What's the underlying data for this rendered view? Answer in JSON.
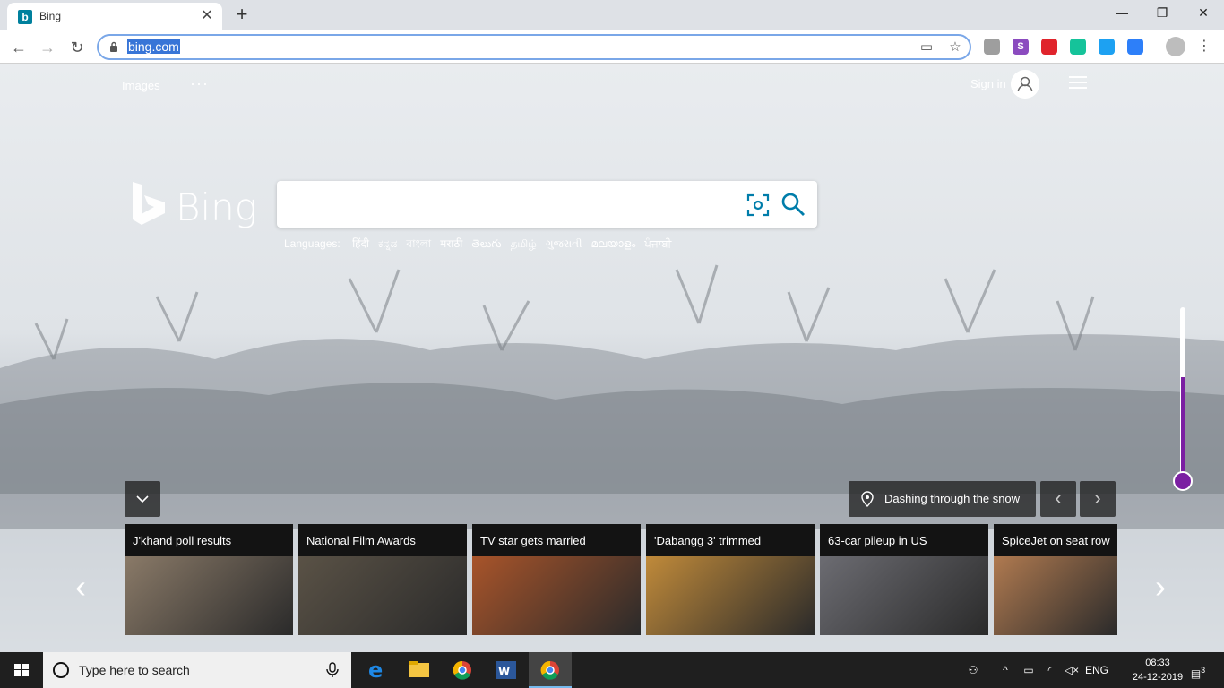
{
  "browser": {
    "tab_title": "Bing",
    "tab_favicon": "b",
    "url": "bing.com",
    "extensions": [
      {
        "icon": "evernote-clipper-icon",
        "color": "#9e9e9e",
        "glyph": ""
      },
      {
        "icon": "s-extension-icon",
        "color": "#8b4bbf",
        "glyph": "S"
      },
      {
        "icon": "adblock-icon",
        "color": "#e0242c",
        "glyph": ""
      },
      {
        "icon": "grammarly-icon",
        "color": "#15c39a",
        "glyph": ""
      },
      {
        "icon": "blue-extension-icon",
        "color": "#1da1f2",
        "glyph": ""
      },
      {
        "icon": "shield-extension-icon",
        "color": "#2d7ff9",
        "glyph": ""
      }
    ]
  },
  "bing": {
    "nav_images": "Images",
    "nav_more": "···",
    "sign_in": "Sign in",
    "logo_text": "Bing",
    "languages_label": "Languages:",
    "languages": [
      "हिंदी",
      "ಕನ್ನಡ",
      "বাংলা",
      "मराठी",
      "తెలుగు",
      "தமிழ்",
      "ગુજરાતી",
      "മലയാളം",
      "ਪੰਜਾਬੀ"
    ],
    "image_caption": "Dashing through the snow",
    "news": [
      {
        "title": "J'khand poll results",
        "thumb": "#8a7a68"
      },
      {
        "title": "National Film Awards",
        "thumb": "#5a5246"
      },
      {
        "title": "TV star gets married",
        "thumb": "#a8542a"
      },
      {
        "title": "'Dabangg 3' trimmed",
        "thumb": "#c08a3a"
      },
      {
        "title": "63-car pileup in US",
        "thumb": "#6c6c72"
      },
      {
        "title": "SpiceJet on seat row",
        "thumb": "#b07a50"
      }
    ]
  },
  "taskbar": {
    "search_placeholder": "Type here to search",
    "language": "ENG",
    "time": "08:33",
    "date": "24-12-2019",
    "notifications": "3"
  }
}
